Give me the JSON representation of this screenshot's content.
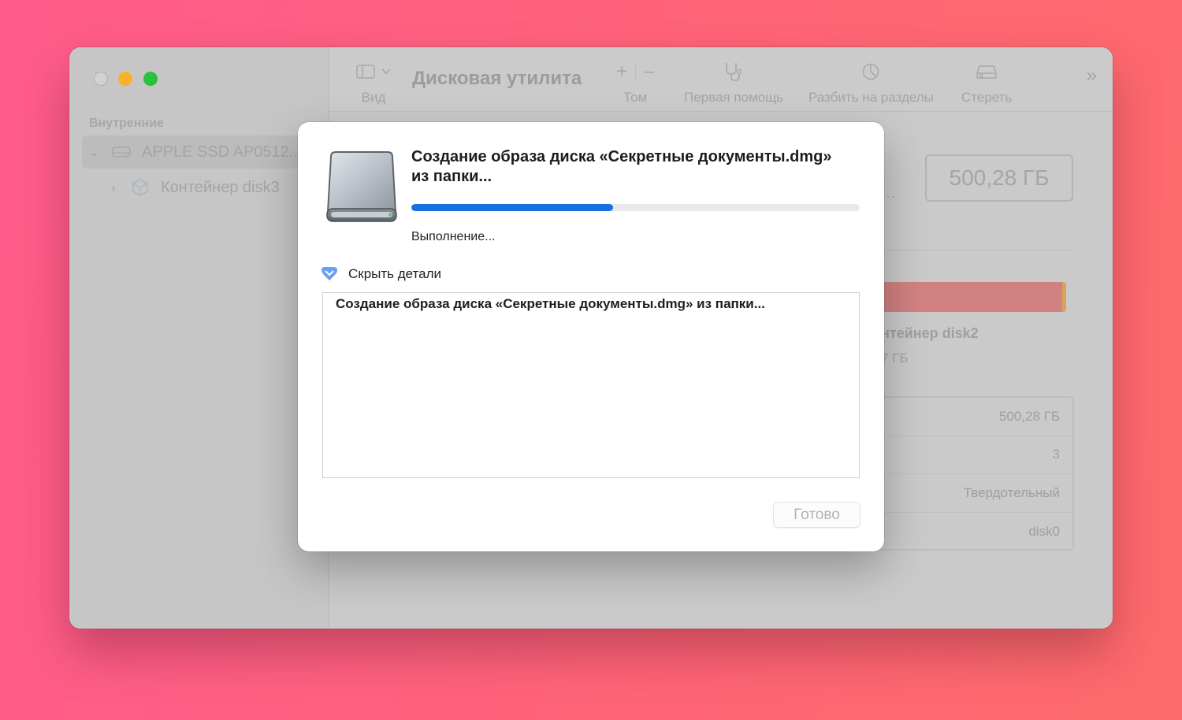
{
  "window": {
    "title": "Дисковая утилита",
    "traffic_lights": [
      "close",
      "minimize",
      "maximize"
    ]
  },
  "toolbar": {
    "view_label": "Вид",
    "volume_label": "Том",
    "first_aid_label": "Первая помощь",
    "partition_label": "Разбить на разделы",
    "erase_label": "Стереть",
    "more_icon": "chevron-double-right-icon"
  },
  "sidebar": {
    "section_label": "Внутренние",
    "items": [
      {
        "label": "APPLE SSD AP0512...",
        "icon": "drive-icon",
        "expanded": true,
        "selected": true
      },
      {
        "label": "Контейнер disk3",
        "icon": "container-icon",
        "expanded": false,
        "selected": false
      }
    ]
  },
  "main": {
    "capacity": "500,28 ГБ",
    "container_name": "нтейнер disk2",
    "container_size": "7 ГБ",
    "info_rows": [
      "500,28 ГБ",
      "3",
      "Твердотельный",
      "disk0"
    ]
  },
  "dialog": {
    "title": "Создание образа диска «Секретные документы.dmg» из папки...",
    "progress_percent": 45,
    "status": "Выполнение...",
    "details_toggle_label": "Скрыть детали",
    "log_text": "Создание образа диска «Секретные документы.dmg» из папки...",
    "done_label": "Готово"
  },
  "colors": {
    "progress": "#1a6fe0",
    "usage_bar": "#d18180",
    "background_from": "#ff5b8c",
    "background_to": "#ff6b6b"
  }
}
